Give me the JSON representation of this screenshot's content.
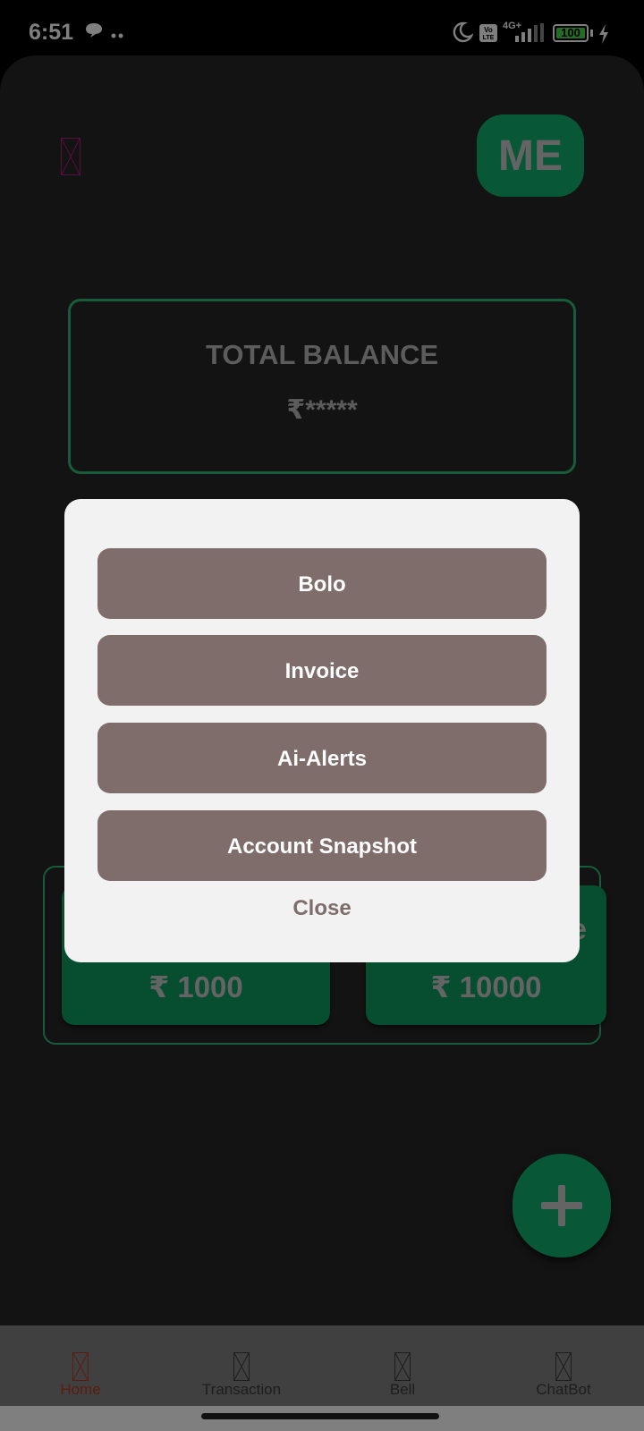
{
  "status_bar": {
    "time": "6:51",
    "network": "4G+",
    "volte": "Vo LTE",
    "battery": "100",
    "icons": [
      "message-bubble-icon",
      "dots-icon",
      "moon-icon",
      "volte-icon",
      "signal-icon",
      "battery-icon",
      "charging-icon"
    ]
  },
  "header": {
    "profile_label": "ME"
  },
  "balance": {
    "title": "TOTAL BALANCE",
    "value": "₹*****"
  },
  "limits": [
    {
      "label": "",
      "value": "₹ 1000"
    },
    {
      "label": "e",
      "value": "₹ 10000"
    }
  ],
  "dialog": {
    "options": [
      "Bolo",
      "Invoice",
      "Ai-Alerts",
      "Account Snapshot"
    ],
    "close_label": "Close"
  },
  "nav": {
    "items": [
      {
        "label": "Home",
        "active": true
      },
      {
        "label": "Transaction",
        "active": false
      },
      {
        "label": "Bell",
        "active": false
      },
      {
        "label": "ChatBot",
        "active": false
      }
    ]
  },
  "colors": {
    "accent_green": "#10b070",
    "dialog_button": "#7f6d6b",
    "nav_active": "#b23a1e"
  }
}
